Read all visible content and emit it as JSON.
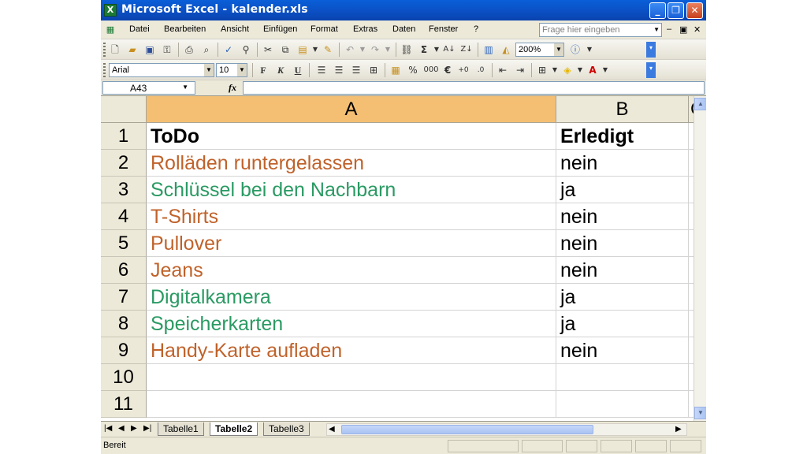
{
  "window": {
    "title": "Microsoft Excel - kalender.xls",
    "app_icon": "excel-icon",
    "title_bar_color": "#0b4ec2"
  },
  "menubar": {
    "items": [
      "Datei",
      "Bearbeiten",
      "Ansicht",
      "Einfügen",
      "Format",
      "Extras",
      "Daten",
      "Fenster",
      "?"
    ],
    "help_placeholder": "Frage hier eingeben"
  },
  "toolbar": {
    "zoom": "200%"
  },
  "format_toolbar": {
    "font": "Arial",
    "size": "10",
    "bold": "F",
    "italic": "K",
    "underline": "U",
    "percent": "%",
    "thousands": "000",
    "euro": "€"
  },
  "formula_bar": {
    "name_box": "A43",
    "fx": "fx",
    "content": ""
  },
  "sheet": {
    "columns": [
      "A",
      "B",
      "C"
    ],
    "selected_column": "A",
    "header_selected_color": "#f4bf73",
    "rows": [
      {
        "num": "1",
        "a": "ToDo",
        "b": "Erledigt",
        "color": "#000000",
        "bold": true
      },
      {
        "num": "2",
        "a": "Rolläden runtergelassen",
        "b": "nein",
        "color": "#c0622a"
      },
      {
        "num": "3",
        "a": "Schlüssel bei den Nachbarn",
        "b": "ja",
        "color": "#2a9a63"
      },
      {
        "num": "4",
        "a": "T-Shirts",
        "b": "nein",
        "color": "#c0622a"
      },
      {
        "num": "5",
        "a": "Pullover",
        "b": "nein",
        "color": "#c0622a"
      },
      {
        "num": "6",
        "a": "Jeans",
        "b": "nein",
        "color": "#c0622a"
      },
      {
        "num": "7",
        "a": "Digitalkamera",
        "b": "ja",
        "color": "#2a9a63"
      },
      {
        "num": "8",
        "a": "Speicherkarten",
        "b": "ja",
        "color": "#2a9a63"
      },
      {
        "num": "9",
        "a": "Handy-Karte aufladen",
        "b": "nein",
        "color": "#c0622a"
      },
      {
        "num": "10",
        "a": "",
        "b": "",
        "color": "#000000"
      },
      {
        "num": "11",
        "a": "",
        "b": "",
        "color": "#000000"
      }
    ]
  },
  "tabs": {
    "items": [
      "Tabelle1",
      "Tabelle2",
      "Tabelle3"
    ],
    "active": "Tabelle2"
  },
  "status": {
    "text": "Bereit"
  }
}
